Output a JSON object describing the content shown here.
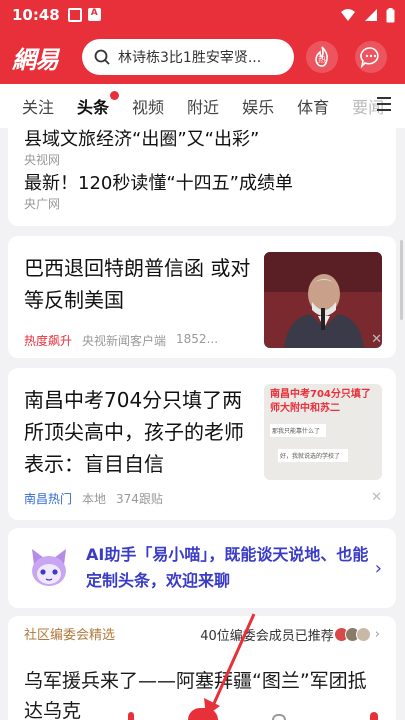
{
  "status_bar": {
    "time": "10:48",
    "notif_icon_2": "A"
  },
  "header": {
    "logo": "網易",
    "search_text": "林诗栋3比1胜安宰贤...",
    "hot_label": "热"
  },
  "tabs": [
    {
      "label": "关注"
    },
    {
      "label": "头条"
    },
    {
      "label": "视频"
    },
    {
      "label": "附近"
    },
    {
      "label": "娱乐"
    },
    {
      "label": "体育"
    },
    {
      "label": "要闻"
    }
  ],
  "top_news": {
    "item1_title": "县域文旅经济“出圈”又“出彩”",
    "item1_source": "央视网",
    "item2_title": "最新！120秒读懂“十四五”成绩单",
    "item2_source": "央广网"
  },
  "card1": {
    "title": "巴西退回特朗普信函 或对等反制美国",
    "tag": "热度飙升",
    "source": "央视新闻客户端",
    "count": "1852..."
  },
  "card2": {
    "title": "南昌中考704分只填了两所顶尖高中，孩子的老师表示：盲目自信",
    "tag": "南昌热门",
    "location": "本地",
    "follows": "374跟贴",
    "thumb_line1": "南昌中考704分只填了",
    "thumb_line2": "师大附中和苏二",
    "thumb_chat1": "那我只能靠什么了",
    "thumb_chat2": "好，我就说选的学校了"
  },
  "ai_card": {
    "text": "AI助手「易小喵」，既能谈天说地、也能定制头条，欢迎来聊"
  },
  "community": {
    "label": "社区编委会精选",
    "recommend": "40位编委会成员已推荐",
    "title": "乌军援兵来了——阿塞拜疆“图兰”军团抵达乌克"
  },
  "colors": {
    "brand_red": "#e8303a",
    "ai_blue": "#3a3cc8"
  }
}
